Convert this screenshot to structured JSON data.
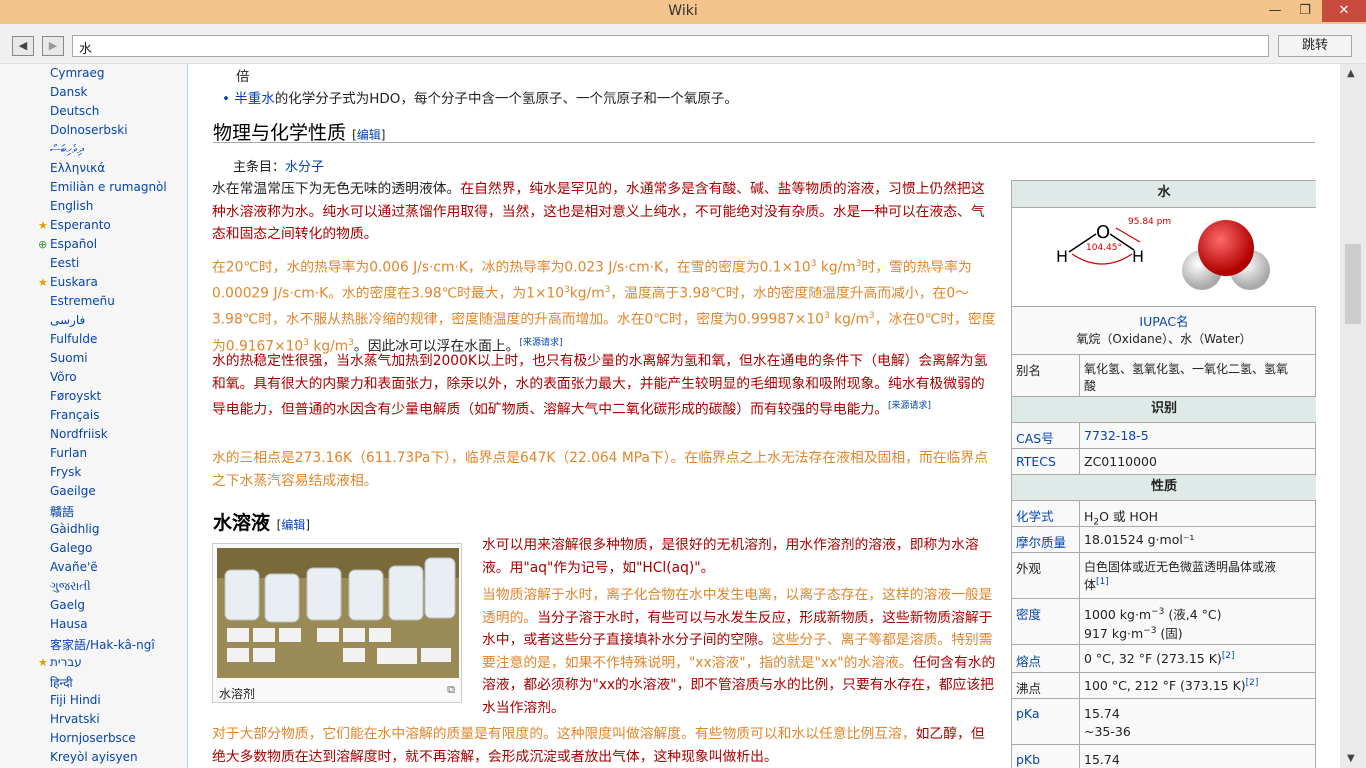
{
  "window": {
    "title": "Wiki",
    "min": "—",
    "max": "❐",
    "close": "✕"
  },
  "nav": {
    "back": "◀",
    "forward": "▶",
    "url": "水",
    "go": "跳转"
  },
  "sidebar": {
    "languages": [
      "Cymraeg",
      "Dansk",
      "Deutsch",
      "Dolnoserbski",
      "ދިވެހިބަސް",
      "Ελληνικά",
      "Emiliàn e rumagnòl",
      "English",
      "Esperanto",
      "Español",
      "Eesti",
      "Euskara",
      "Estremeñu",
      "فارسی",
      "Fulfulde",
      "Suomi",
      "Võro",
      "Føroyskt",
      "Français",
      "Nordfriisk",
      "Furlan",
      "Frysk",
      "Gaeilge",
      "贛語",
      "Gàidhlig",
      "Galego",
      "Avañe'ẽ",
      "ગુજરાતી",
      "Gaelg",
      "Hausa",
      "客家語/Hak-kâ-ngî",
      "עברית",
      "हिन्दी",
      "Fiji Hindi",
      "Hrvatski",
      "Hornjoserbsce",
      "Kreyòl ayisyen"
    ],
    "star_esperanto": "★",
    "star_espanol": "⊕",
    "star_euskara": "★",
    "star_hebrew": "★"
  },
  "article": {
    "top_fragment": "倍",
    "bullet_link": "半重水",
    "bullet_text": "的化学分子式为HDO，每个分子中含一个氢原子、一个氘原子和一个氧原子。",
    "h_props": "物理与化学性质",
    "edit": "[编辑]",
    "main_article_label": "主条目：",
    "main_article_link": "水分子",
    "p1_a": "水在常温常压下为无色无味的透明液体。",
    "p1_b": "在自然界，纯水是罕见的，水通常多是含有酸、碱、盐等物质的溶液，习惯上仍然把这种水溶液称为水。纯水可以通过蒸馏作用取得，当然，这也是相对意义上纯水，不可能绝对没有杂质。水是一种可以在液态、气态和固态之间转化的物质。",
    "p2_a": "在20℃时，水的热导率为0.006 J/s·cm·K，冰的热导率为0.023 J/s·cm·K，在雪的密度为0.1×10",
    "p2_b": " kg/m",
    "p2_c": "时，雪的热导率为0.00029 J/s·cm·K。水的密度在3.98℃时最大，为1×10",
    "p2_d": "kg/m",
    "p2_e": "，温度高于3.98℃时，水的密度随温度升高而减小，在0～3.98℃时，水不服从热胀冷缩的规律，密度随温度的升高而增加。水在0℃时，密度为0.99987×10",
    "p2_f": " kg/m",
    "p2_g": "，冰在0℃时，密度为0.9167×10",
    "p2_h": " kg/m",
    "p2_i": "。因此冰可以浮在水面上。",
    "sup3": "3",
    "cite_needed": "[来源请求]",
    "p3": "水的热稳定性很强，当水蒸气加热到2000K以上时，也只有极少量的水离解为氢和氧，但水在通电的条件下（电解）会离解为氢和氧。具有很大的内聚力和表面张力，除汞以外，水的表面张力最大，并能产生较明显的毛细现象和吸附现象。纯水有极微弱的导电能力，但普通的水因含有少量电解质（如矿物质、溶解大气中二氧化碳形成的碳酸）而有较强的导电能力。",
    "p4": "水的三相点是273.16K（611.73Pa下），临界点是647K（22.064 MPa下）。在临界点之上水无法存在液相及固相，而在临界点之下水蒸汽容易结成液相。",
    "h_solution": "水溶液",
    "thumb_caption": "水溶剂",
    "s1": "水可以用来溶解很多种物质，是很好的无机溶剂，用水作溶剂的溶液，即称为水溶液。用\"aq\"作为记号，如\"HCl(aq)\"。",
    "s2_a": "当物质溶解于水时，离子化合物在水中发生电离，以离子态存在，这样的溶液一般是透明的。",
    "s2_b": "当分子溶于水时，有些可以与水发生反应，形成新物质，这些新物质溶解于水中，或者这些分子直接填补水分子间的空隙。",
    "s2_c": "这些分子、离子等都是溶质。特别需要注意的是，如果不作特殊说明，\"xx溶液\"，指的就是\"xx\"的水溶液。",
    "s2_d": "任何含有水的溶液，都必须称为\"xx的水溶液\"，即不管溶质与水的比例，只要有水存在，都应该把水当作溶剂。",
    "s3": "对于大部分物质，它们能在水中溶解的质量是有限度的。这种限度叫做溶解度。有些物质可以和水以任意比例互溶，",
    "s4": "如乙醇，但绝大多数物质在达到溶解度时，就不再溶解，会形成沉淀或者放出气体，这种现象叫做析出。"
  },
  "infobox": {
    "title": "水",
    "angle": "104.45°",
    "bond": "95.84 pm",
    "iupac_label": "IUPAC名",
    "iupac_value": "氧烷（Oxidane）、水（Water）",
    "alias_label": "别名",
    "alias_value_1": "氧化氢、氢氧化氢、一氧化二氢、氢氧",
    "alias_value_2": "酸",
    "ident": "识别",
    "cas_label": "CAS号",
    "cas_value": "7732-18-5",
    "rtecs_label": "RTECS",
    "rtecs_value": "ZC0110000",
    "props": "性质",
    "formula_label": "化学式",
    "formula_value": "H",
    "formula_sub": "2",
    "formula_rest": "O 或 HOH",
    "molar_label": "摩尔质量",
    "molar_value": "18.01524 g·mol⁻¹",
    "appear_label": "外观",
    "appear_value_1": "白色固体或近无色微蓝透明晶体或液",
    "appear_value_2": "体",
    "ref1": "[1]",
    "density_label": "密度",
    "density_value_1": "1000 kg·m",
    "density_exp": "−3",
    "density_value_1b": " (液,4 °C)",
    "density_value_2": "917 kg·m",
    "density_value_2b": " (固)",
    "mp_label": "熔点",
    "mp_value": "0 °C, 32 °F (273.15 K)",
    "ref2": "[2]",
    "bp_label": "沸点",
    "bp_value": "100 °C, 212 °F (373.15 K)",
    "pka_label": "pKa",
    "pka_value_1": "15.74",
    "pka_value_2": "~35-36",
    "pkb_label": "pKb",
    "pkb_value": "15.74"
  }
}
